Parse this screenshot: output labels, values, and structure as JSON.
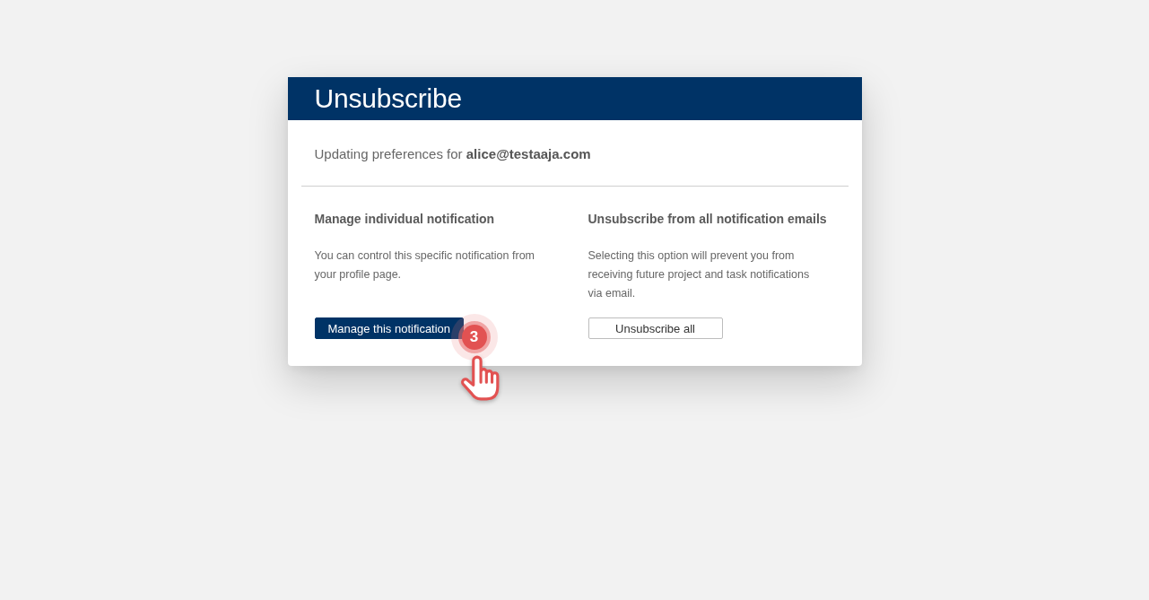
{
  "dialog": {
    "title": "Unsubscribe",
    "intro": "Updating preferences for **alice@testaaja.com**"
  },
  "options": [
    {
      "heading": "Manage individual notification",
      "description": "You can control this specific notification from your profile page.",
      "button": {
        "label": "Manage this notification",
        "kind": "primary",
        "step_marker": "3"
      }
    },
    {
      "heading": "Unsubscribe from all notification emails",
      "description": "Selecting this option will prevent you from receiving future project and task notifications via email.",
      "button": {
        "label": "Unsubscribe all",
        "kind": "secondary"
      }
    }
  ]
}
